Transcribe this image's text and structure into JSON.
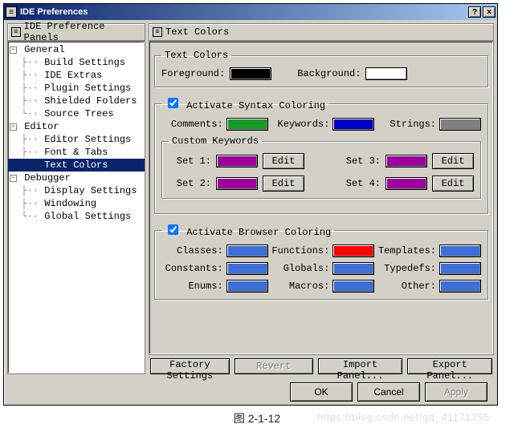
{
  "window": {
    "title": "IDE Preferences"
  },
  "left": {
    "header": "IDE Preference Panels",
    "groups": [
      {
        "label": "General",
        "expanded": true,
        "items": [
          "Build Settings",
          "IDE Extras",
          "Plugin Settings",
          "Shielded Folders",
          "Source Trees"
        ]
      },
      {
        "label": "Editor",
        "expanded": true,
        "items": [
          "Editor Settings",
          "Font & Tabs",
          "Text Colors"
        ],
        "selected": "Text Colors"
      },
      {
        "label": "Debugger",
        "expanded": true,
        "items": [
          "Display Settings",
          "Windowing",
          "Global Settings"
        ]
      }
    ]
  },
  "right": {
    "header": "Text Colors",
    "textcolors": {
      "legend": "Text Colors",
      "foreground_label": "Foreground:",
      "foreground_color": "#000000",
      "background_label": "Background:",
      "background_color": "#ffffff"
    },
    "syntax": {
      "checkbox_label": "Activate Syntax Coloring",
      "checked": true,
      "comments_label": "Comments:",
      "comments_color": "#169a2a",
      "keywords_label": "Keywords:",
      "keywords_color": "#0000c0",
      "strings_label": "Strings:",
      "strings_color": "#808080",
      "custom": {
        "legend": "Custom Keywords",
        "edit_label": "Edit",
        "sets": [
          {
            "label": "Set 1:",
            "color": "#9b009b"
          },
          {
            "label": "Set 2:",
            "color": "#9b009b"
          },
          {
            "label": "Set 3:",
            "color": "#9b009b"
          },
          {
            "label": "Set 4:",
            "color": "#9b009b"
          }
        ]
      }
    },
    "browser": {
      "checkbox_label": "Activate Browser Coloring",
      "checked": true,
      "items": [
        {
          "label": "Classes:",
          "color": "#3d6fd6"
        },
        {
          "label": "Functions:",
          "color": "#ff0000"
        },
        {
          "label": "Templates:",
          "color": "#3d6fd6"
        },
        {
          "label": "Constants:",
          "color": "#3d6fd6"
        },
        {
          "label": "Globals:",
          "color": "#3d6fd6"
        },
        {
          "label": "Typedefs:",
          "color": "#3d6fd6"
        },
        {
          "label": "Enums:",
          "color": "#3d6fd6"
        },
        {
          "label": "Macros:",
          "color": "#3d6fd6"
        },
        {
          "label": "Other:",
          "color": "#3d6fd6"
        }
      ]
    }
  },
  "buttons": {
    "factory": "Factory Settings",
    "revert": "Revert",
    "import": "Import Panel...",
    "export": "Export Panel...",
    "ok": "OK",
    "cancel": "Cancel",
    "apply": "Apply"
  },
  "caption": "图 2-1-12",
  "watermark": "https://blog.csdn.net/qq_41171755"
}
